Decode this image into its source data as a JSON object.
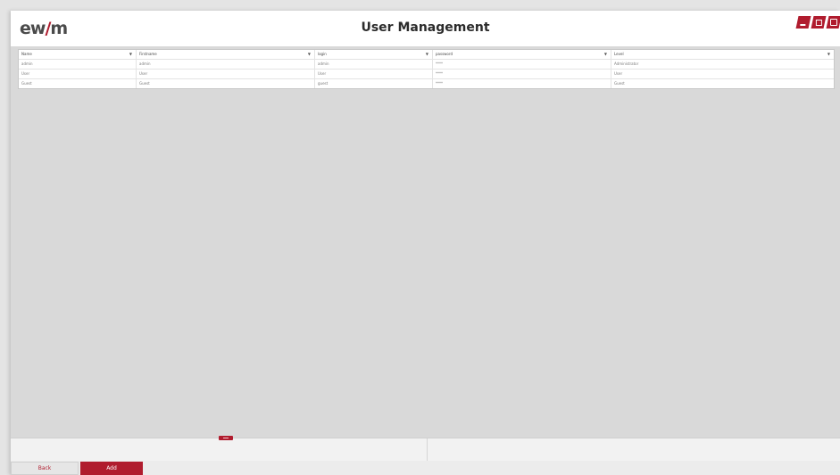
{
  "app": {
    "logo": {
      "part1": "ew",
      "part2": "/",
      "part3": "m"
    },
    "title": "User Management",
    "window_controls": [
      "minimize-icon",
      "maximize-icon",
      "close-icon"
    ],
    "accent_color": "#b01c2e"
  },
  "table": {
    "columns": [
      "Name",
      "Firstname",
      "login",
      "password",
      "Level"
    ],
    "rows": [
      [
        "admin",
        "admin",
        "admin",
        "****",
        "Administrator"
      ],
      [
        "User",
        "User",
        "User",
        "****",
        "User"
      ],
      [
        "Guest",
        "Guest",
        "guest",
        "****",
        "Guest"
      ]
    ]
  },
  "footer": {
    "back_label": "Back",
    "add_label": "Add"
  }
}
